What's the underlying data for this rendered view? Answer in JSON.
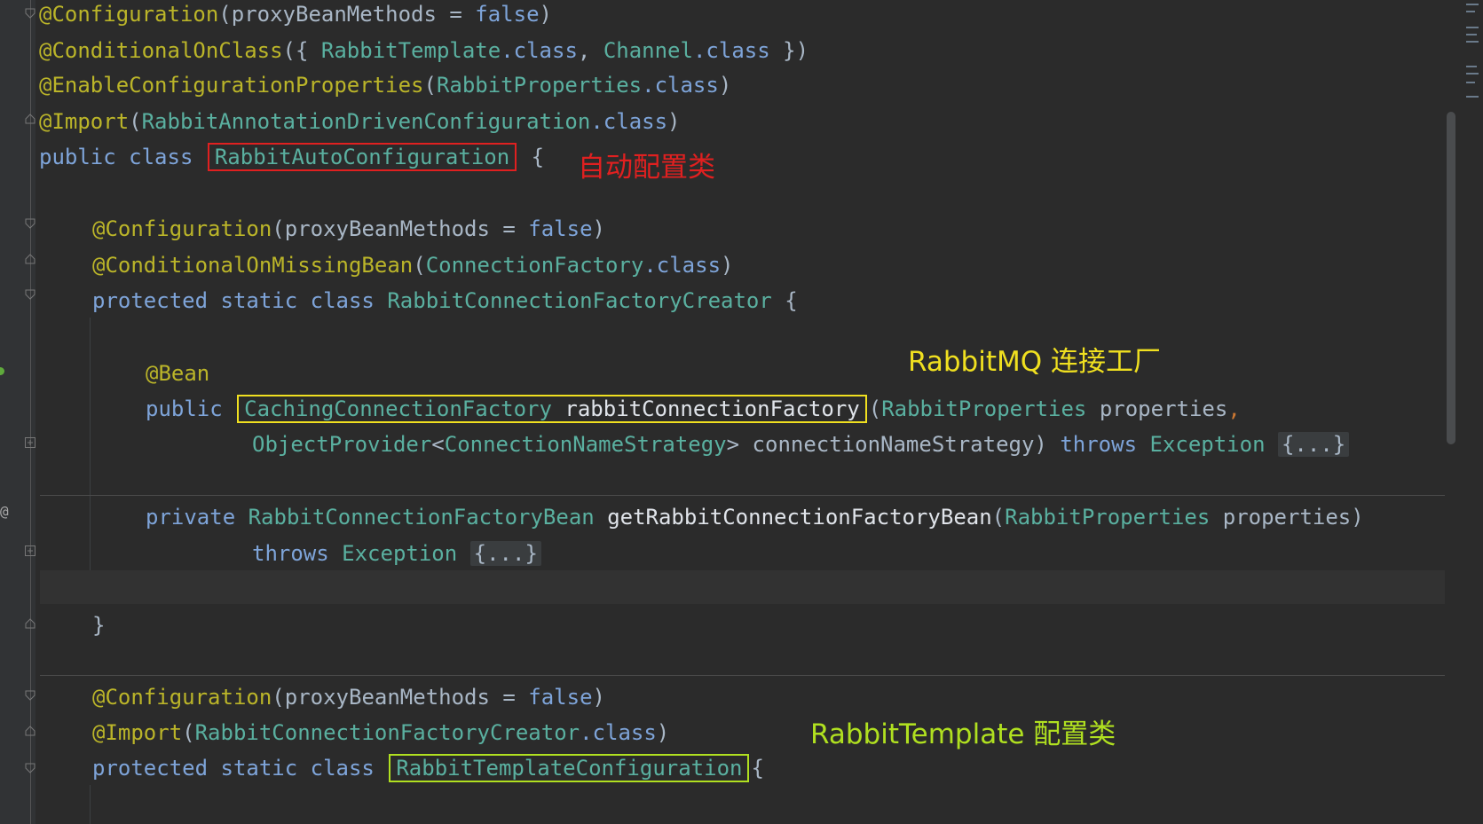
{
  "code_lines": {
    "l1": {
      "ann": "@Configuration",
      "p1": "(proxyBeanMethods = ",
      "kw1": "false",
      "p2": ")"
    },
    "l2": {
      "ann": "@ConditionalOnClass",
      "p1": "({ ",
      "c1": "RabbitTemplate",
      "kw1": ".class",
      "p2": ", ",
      "c2": "Channel",
      "kw2": ".class",
      "p3": " })"
    },
    "l3": {
      "ann": "@EnableConfigurationProperties",
      "p1": "(",
      "c1": "RabbitProperties",
      "kw1": ".class",
      "p2": ")"
    },
    "l4": {
      "ann": "@Import",
      "p1": "(",
      "c1": "RabbitAnnotationDrivenConfiguration",
      "kw1": ".class",
      "p2": ")"
    },
    "l5": {
      "kw1": "public class ",
      "boxed": "RabbitAutoConfiguration",
      "p1": " {"
    },
    "l6": {
      "ann": "@Configuration",
      "p1": "(proxyBeanMethods = ",
      "kw1": "false",
      "p2": ")"
    },
    "l7": {
      "ann": "@ConditionalOnMissingBean",
      "p1": "(",
      "c1": "ConnectionFactory",
      "kw1": ".class",
      "p2": ")"
    },
    "l8": {
      "kw1": "protected static class ",
      "c1": "RabbitConnectionFactoryCreator",
      "p1": " {"
    },
    "l9": {
      "ann": "@Bean"
    },
    "l10": {
      "kw1": "public ",
      "boxed_cls": "CachingConnectionFactory",
      "boxed_method": "rabbitConnectionFactory",
      "p1": "(",
      "c1": "RabbitProperties",
      "p2": " properties",
      "p3": ","
    },
    "l11": {
      "c1": "ObjectProvider",
      "p1": "<",
      "c2": "ConnectionNameStrategy",
      "p2": "> connectionNameStrategy) ",
      "kw1": "throws ",
      "c3": "Exception",
      "p3": " ",
      "fold": "{...}"
    },
    "l12": {
      "kw1": "private ",
      "c1": "RabbitConnectionFactoryBean",
      "p1": " ",
      "m1": "getRabbitConnectionFactoryBean",
      "p2": "(",
      "c2": "RabbitProperties",
      "p3": " properties)"
    },
    "l13": {
      "kw1": "throws ",
      "c1": "Exception",
      "p1": " ",
      "fold": "{...}"
    },
    "l14": {
      "p1": "}"
    },
    "l15": {
      "ann": "@Configuration",
      "p1": "(proxyBeanMethods = ",
      "kw1": "false",
      "p2": ")"
    },
    "l16": {
      "ann": "@Import",
      "p1": "(",
      "c1": "RabbitConnectionFactoryCreator",
      "kw1": ".class",
      "p2": ")"
    },
    "l17": {
      "kw1": "protected static class ",
      "boxed": "RabbitTemplateConfiguration",
      "p1": "{"
    }
  },
  "annotations": {
    "auto_config": "自动配置类",
    "connection_factory": "RabbitMQ 连接工厂",
    "template_config": "RabbitTemplate 配置类"
  },
  "gutter": {
    "at_mark": "@"
  },
  "colors": {
    "background": "#2b2b2b",
    "red_label": "#e02020",
    "yellow_label": "#f0e020",
    "green_label": "#b0e020"
  }
}
